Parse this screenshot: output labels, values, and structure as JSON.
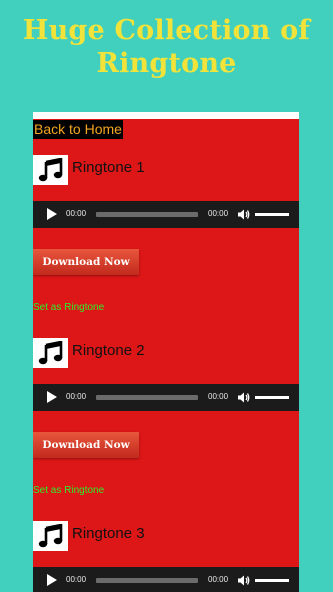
{
  "header": {
    "title_line1": "Huge Collection of",
    "title_line2": "Ringtone"
  },
  "nav": {
    "back_label": "Back to Home"
  },
  "colors": {
    "background": "#40d0bd",
    "title": "#f2e33a",
    "panel": "#dd1717",
    "back_text": "#f3a623",
    "set_ringtone_text": "#2af02a",
    "player": "#1b1b1b"
  },
  "ringtones": [
    {
      "title": "Ringtone 1",
      "icon": "music-note-icon",
      "current_time": "00:00",
      "total_time": "00:00",
      "download_label": "Download Now",
      "set_label": "Set as Ringtone"
    },
    {
      "title": "Ringtone 2",
      "icon": "music-note-icon",
      "current_time": "00:00",
      "total_time": "00:00",
      "download_label": "Download Now",
      "set_label": "Set as Ringtone"
    },
    {
      "title": "Ringtone 3",
      "icon": "music-note-icon",
      "current_time": "00:00",
      "total_time": "00:00"
    }
  ]
}
